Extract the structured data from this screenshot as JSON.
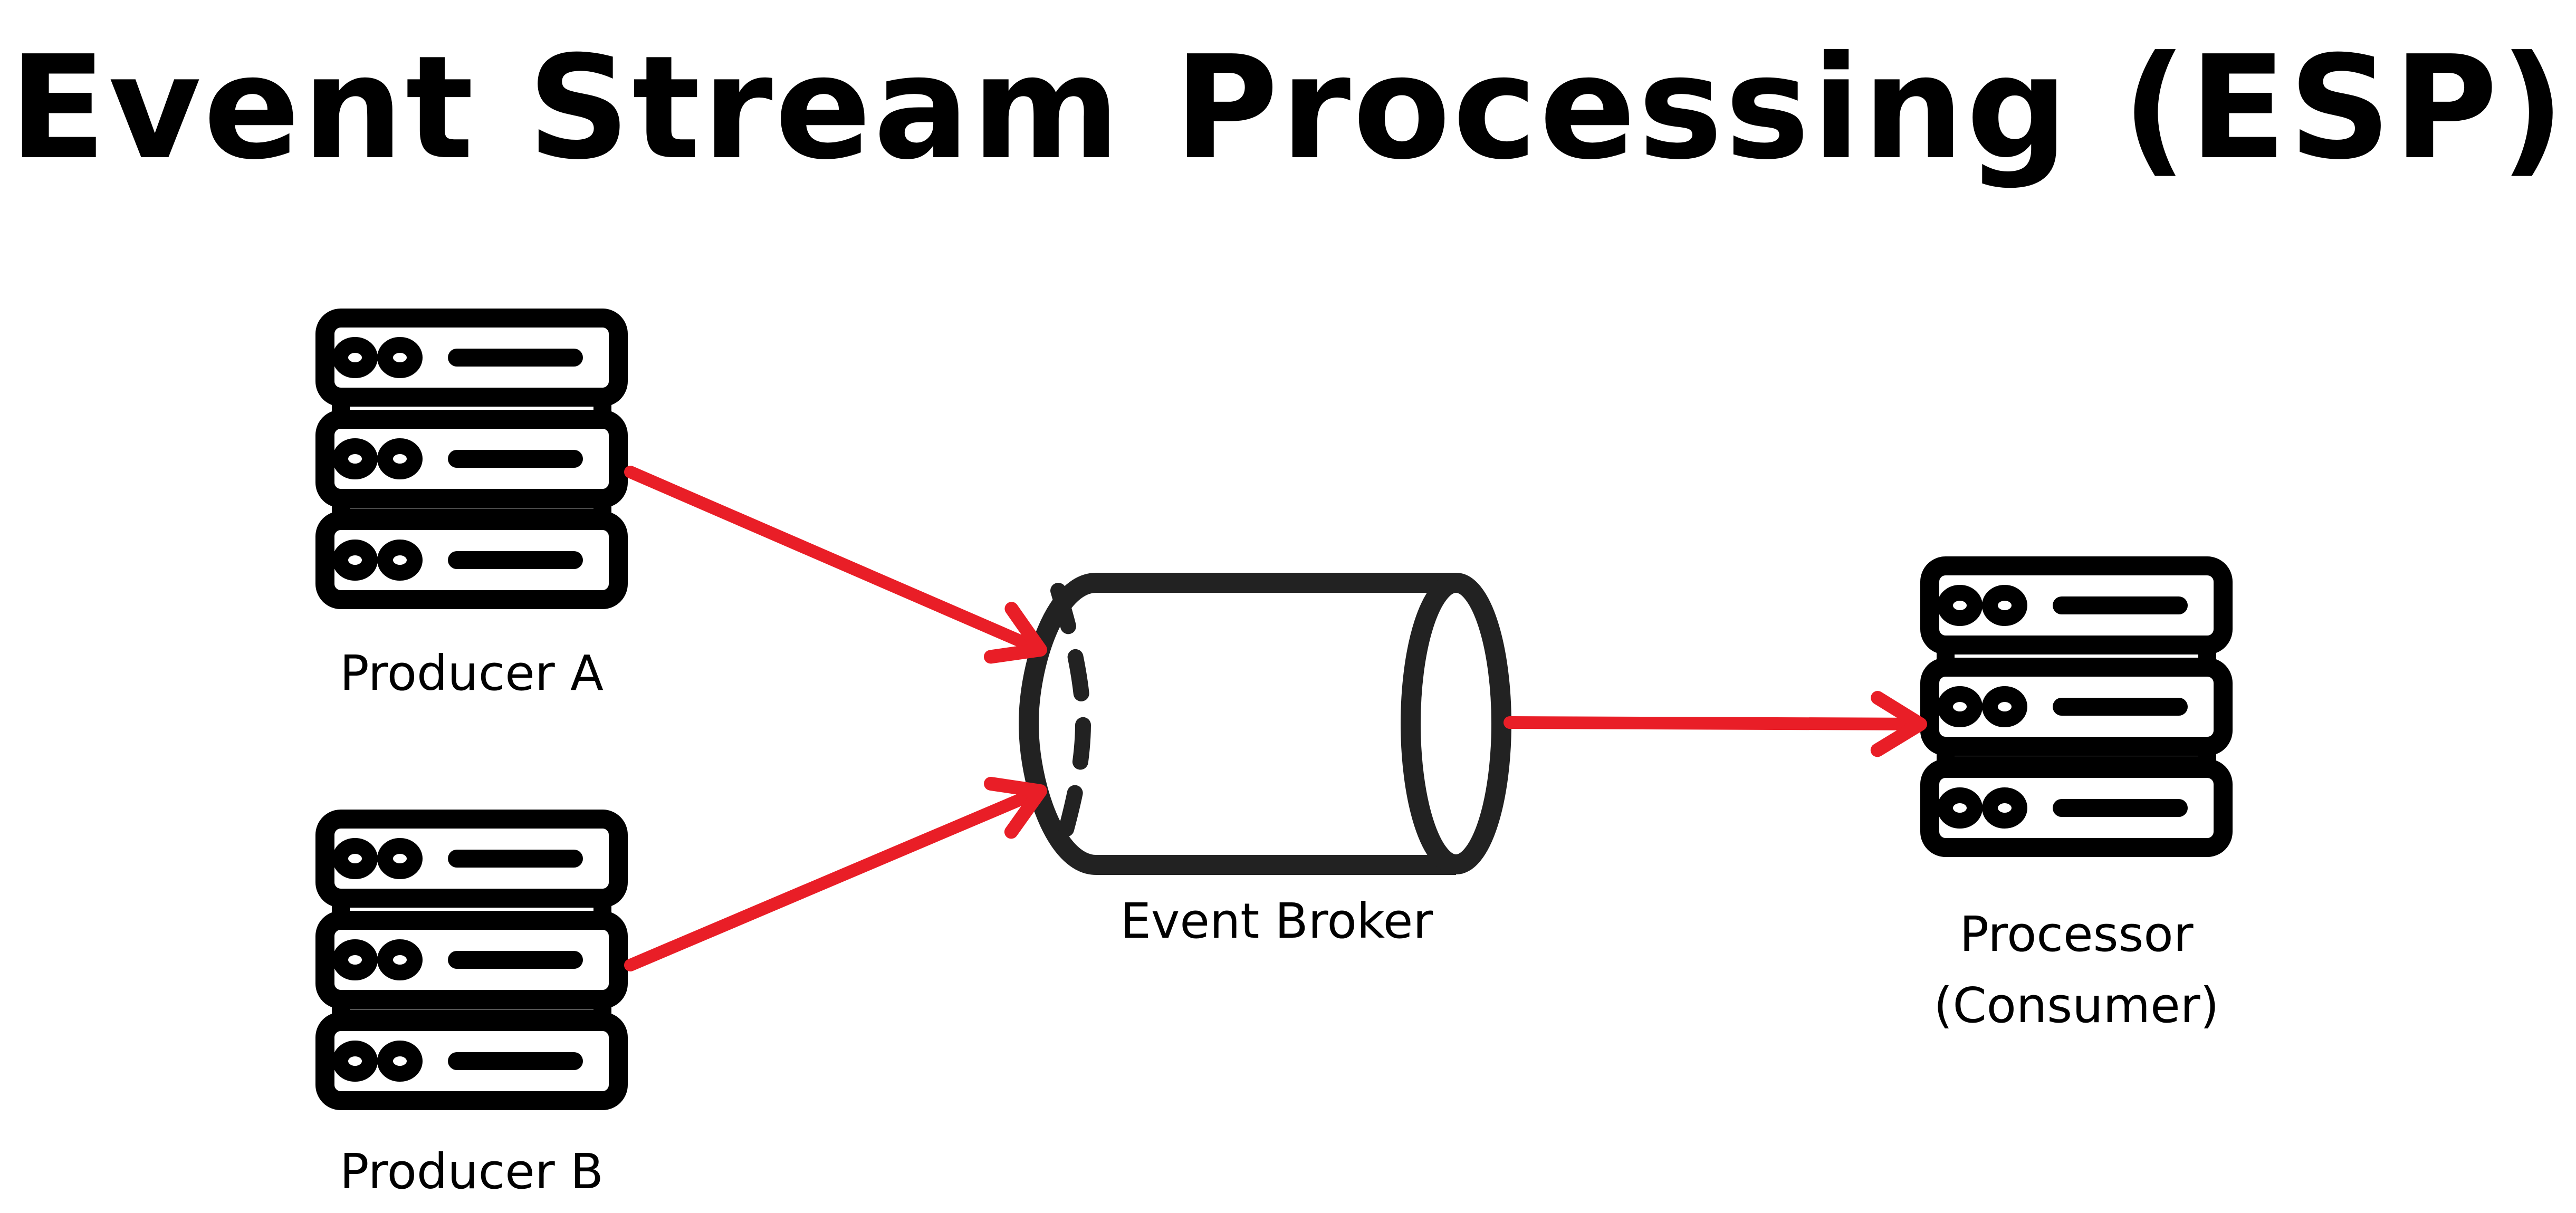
{
  "title": "Event Stream Processing (ESP)",
  "colors": {
    "arrow": "#E91E27",
    "outline": "#000000",
    "broker_outline": "#222222",
    "background": "#FFFFFF"
  },
  "nodes": {
    "producer_a": {
      "label": "Producer A",
      "icon": "server-rack-icon"
    },
    "producer_b": {
      "label": "Producer B",
      "icon": "server-rack-icon"
    },
    "broker": {
      "label": "Event Broker",
      "icon": "cylinder-queue-icon"
    },
    "processor": {
      "label_line1": "Processor",
      "label_line2": "(Consumer)",
      "icon": "server-rack-icon"
    }
  },
  "edges": [
    {
      "from": "producer_a",
      "to": "broker"
    },
    {
      "from": "producer_b",
      "to": "broker"
    },
    {
      "from": "broker",
      "to": "processor"
    }
  ]
}
